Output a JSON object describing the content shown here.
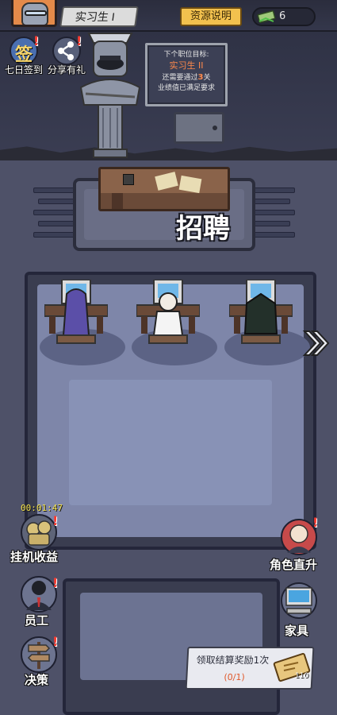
{
  "header": {
    "rank": "实习生 I",
    "resource_button": "资源说明",
    "money_amount": "6"
  },
  "quick_actions": {
    "daily_signin_glyph": "签",
    "daily_signin": "七日签到",
    "share": "分享有礼"
  },
  "goal_board": {
    "line1": "下个职位目标:",
    "rank": "实习生 II",
    "line3_prefix": "还需要通过",
    "line3_num": "3",
    "line3_suffix": "关",
    "line4": "业绩值已满足要求"
  },
  "recruit": {
    "title": "招聘"
  },
  "side_buttons": {
    "idle_timer": "00:01:47",
    "idle_income": "挂机收益",
    "role_upgrade": "角色直升",
    "staff": "员工",
    "furniture": "家具",
    "decision": "决策"
  },
  "reward": {
    "title": "领取结算奖励1次",
    "progress": "(0/1)",
    "count": "110"
  },
  "colors": {
    "accent": "#f2c14e",
    "alert": "#ff3b30",
    "floor": "#4e5168",
    "office_floor": "#7e86a9"
  },
  "icons": [
    "cash-icon",
    "share-icon",
    "boss-statue",
    "safe-icon",
    "next-arrow-icon",
    "idle-income-icon",
    "role-upgrade-icon",
    "staff-icon",
    "furniture-icon",
    "decision-icon",
    "ticket-icon"
  ]
}
